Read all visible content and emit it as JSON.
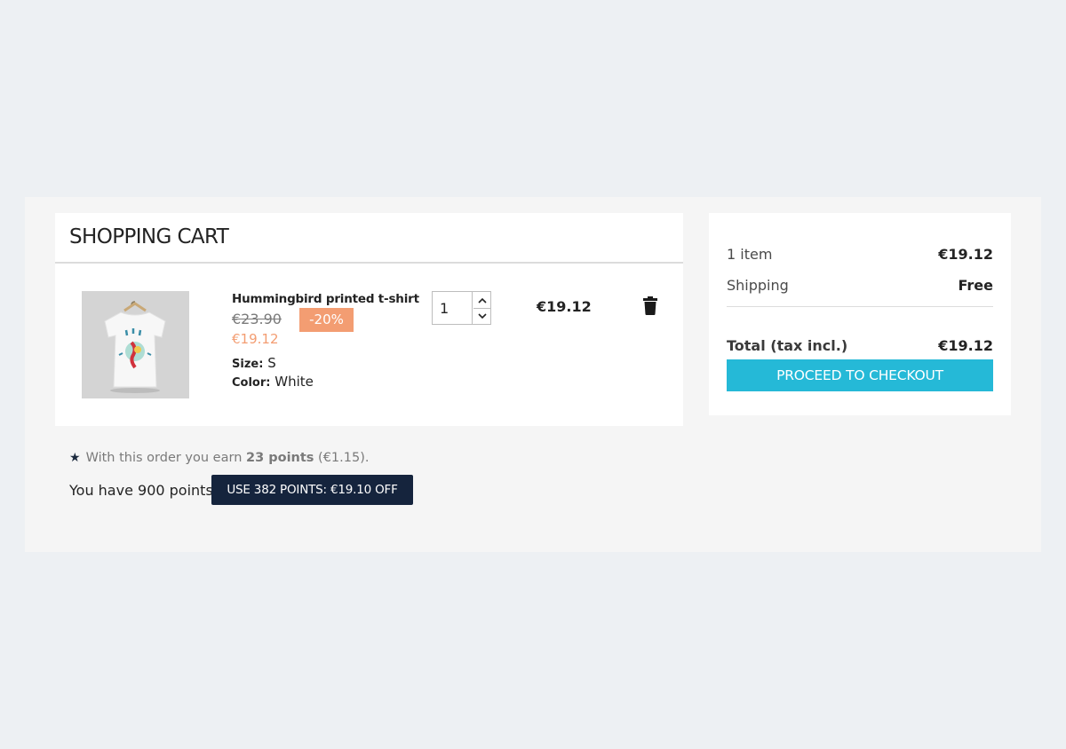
{
  "cart": {
    "title": "SHOPPING CART",
    "item": {
      "name": "Hummingbird printed t-shirt",
      "regular_price": "€23.90",
      "discount": "-20%",
      "price": "€19.12",
      "attributes": [
        {
          "key": "Size:",
          "value": "S"
        },
        {
          "key": "Color:",
          "value": "White"
        }
      ],
      "quantity": "1",
      "line_total": "€19.12"
    }
  },
  "loyalty": {
    "prefix": "With this order you earn",
    "points_earned": "23 points",
    "suffix": "(€1.15).",
    "balance_text": "You have 900 points.",
    "use_button_label": "USE 382 POINTS: €19.10 OFF"
  },
  "summary": {
    "items_label": "1 item",
    "items_value": "€19.12",
    "shipping_label": "Shipping",
    "shipping_value": "Free",
    "total_label": "Total (tax incl.)",
    "total_value": "€19.12",
    "checkout_label": "PROCEED TO CHECKOUT"
  },
  "colors": {
    "accent": "#25b9d7",
    "discount": "#f39d72",
    "dark_button": "#15243d"
  }
}
